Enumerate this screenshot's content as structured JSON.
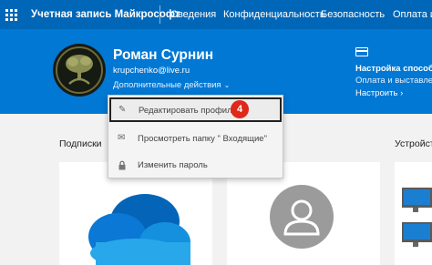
{
  "topbar": {
    "app_title": "Учетная запись Майкрософт",
    "nav": [
      "Сведения",
      "Конфиденциальность",
      "Безопасность",
      "Оплата и в"
    ]
  },
  "profile": {
    "name": "Роман Сурнин",
    "email": "krupchenko@live.ru",
    "more_actions": "Дополнительные действия"
  },
  "payment": {
    "title": "Настройка способа о",
    "subtitle": "Оплата и выставлени",
    "action": "Настроить"
  },
  "menu": {
    "items": [
      {
        "label": "Редактировать профиль",
        "icon": "pencil-icon"
      },
      {
        "label": "Просмотреть папку \" Входящие\"",
        "icon": "mail-icon"
      },
      {
        "label": "Изменить пароль",
        "icon": "lock-icon"
      }
    ],
    "step_badge": "4"
  },
  "sections": {
    "subscriptions": "Подписки",
    "devices": "Устройст"
  },
  "colors": {
    "topbar": "#0067b8",
    "band": "#0078d4",
    "badge": "#e0281a"
  }
}
